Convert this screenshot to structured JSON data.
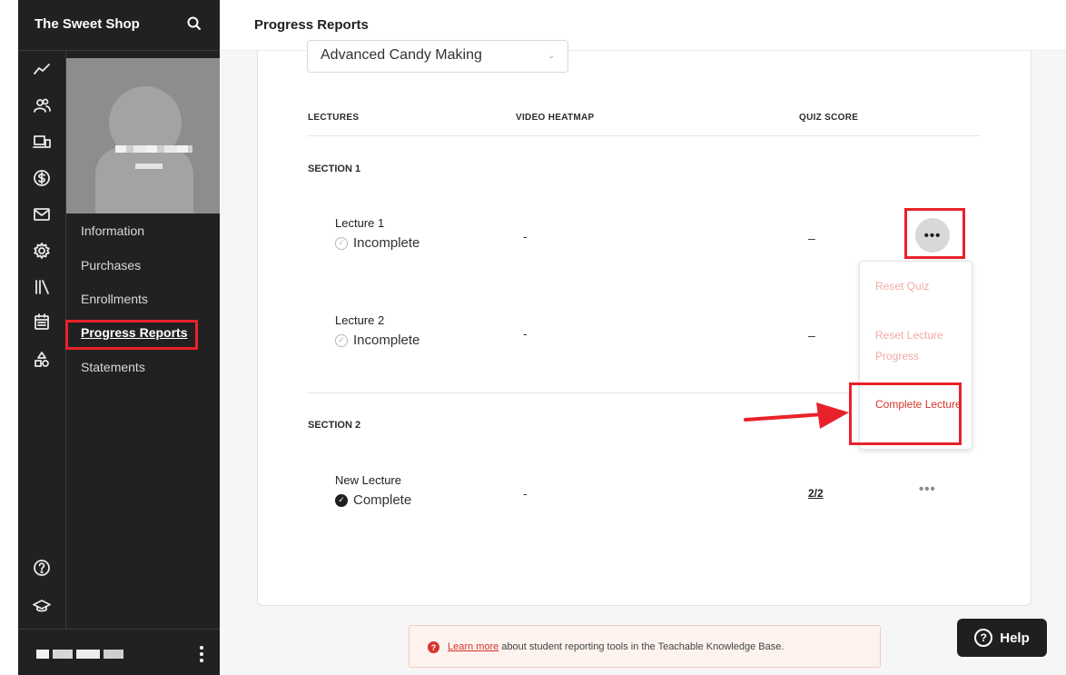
{
  "app": {
    "brand": "The Sweet Shop"
  },
  "header": {
    "title": "Progress Reports"
  },
  "sidebar": {
    "items": [
      {
        "label": "Information"
      },
      {
        "label": "Purchases"
      },
      {
        "label": "Enrollments"
      },
      {
        "label": "Progress Reports",
        "active": true
      },
      {
        "label": "Statements"
      }
    ]
  },
  "rail_icons": [
    "trend-icon",
    "users-icon",
    "devices-icon",
    "dollar-icon",
    "mail-icon",
    "gear-icon",
    "library-icon",
    "calendar-icon",
    "shapes-icon",
    "help-circle-icon",
    "graduation-cap-icon"
  ],
  "course": {
    "selected": "Advanced Candy Making"
  },
  "table": {
    "columns": [
      "LECTURES",
      "VIDEO HEATMAP",
      "QUIZ SCORE"
    ],
    "sections": [
      {
        "name": "SECTION 1",
        "lectures": [
          {
            "title": "Lecture 1",
            "status": "Incomplete",
            "heatmap": "-",
            "quiz": "–"
          },
          {
            "title": "Lecture 2",
            "status": "Incomplete",
            "heatmap": "-",
            "quiz": "–"
          }
        ]
      },
      {
        "name": "SECTION 2",
        "lectures": [
          {
            "title": "New Lecture",
            "status": "Complete",
            "heatmap": "-",
            "quiz": "2/2"
          }
        ]
      }
    ]
  },
  "menu": {
    "more_label": "•••",
    "items": [
      {
        "label": "Reset Quiz",
        "enabled": false
      },
      {
        "label": "Reset Lecture Progress",
        "enabled": false
      },
      {
        "label": "Complete Lecture",
        "enabled": true
      }
    ]
  },
  "kb_note": {
    "link": "Learn more",
    "text": " about student reporting tools in the Teachable Knowledge Base."
  },
  "help": {
    "label": "Help"
  },
  "colors": {
    "accent": "#e8222a",
    "sidebar": "#212121",
    "link": "#d6342c"
  }
}
